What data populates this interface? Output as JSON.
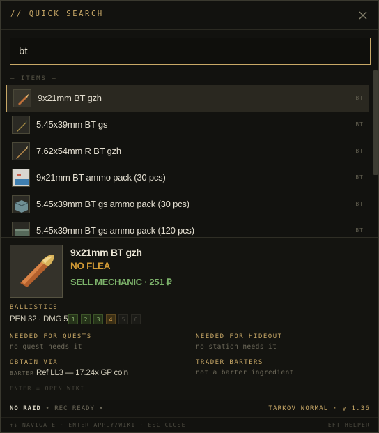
{
  "header": {
    "title": "// QUICK SEARCH",
    "close_icon": "close-icon"
  },
  "search": {
    "value": "bt",
    "placeholder": ""
  },
  "list": {
    "section_label": "— ITEMS —",
    "items": [
      {
        "name": "9x21mm BT gzh",
        "tag": "BT",
        "icon": "bullet-icon",
        "selected": true
      },
      {
        "name": "5.45x39mm BT gs",
        "tag": "BT",
        "icon": "rifle-round-icon",
        "selected": false
      },
      {
        "name": "7.62x54mm R BT gzh",
        "tag": "BT",
        "icon": "rifle-round-icon",
        "selected": false
      },
      {
        "name": "9x21mm BT ammo pack (30 pcs)",
        "tag": "BT",
        "icon": "ammo-pack-icon",
        "selected": false
      },
      {
        "name": "5.45x39mm BT gs ammo pack (30 pcs)",
        "tag": "BT",
        "icon": "ammo-box-icon",
        "selected": false
      },
      {
        "name": "5.45x39mm BT gs ammo pack (120 pcs)",
        "tag": "BT",
        "icon": "ammo-box-icon",
        "selected": false
      }
    ]
  },
  "detail": {
    "name": "9x21mm BT gzh",
    "flea": "NO FLEA",
    "sell": "SELL MECHANIC · 251 ₽",
    "ballistics_label": "BALLISTICS",
    "ballistics_stats": "PEN 32 · DMG 52",
    "armor_classes": [
      "1",
      "2",
      "3",
      "4",
      "5",
      "6"
    ],
    "quests_label": "NEEDED FOR QUESTS",
    "quests_value": "no quest needs it",
    "hideout_label": "NEEDED FOR HIDEOUT",
    "hideout_value": "no station needs it",
    "obtain_label": "OBTAIN VIA",
    "barters_label": "TRADER BARTERS",
    "barters_value": "not a barter ingredient",
    "obtain_kind": "BARTER",
    "obtain_value": "Ref LL3 — 17.24x GP coin",
    "hint": "ENTER = OPEN WIKI"
  },
  "status": {
    "raid": "NO RAID",
    "rec": "• REC READY •",
    "mode": "TARKOV NORMAL · γ 1.36"
  },
  "footer": {
    "keys": "↑↓ NAVIGATE · ENTER APPLY/WIKI · ESC CLOSE",
    "brand": "EFT HELPER"
  },
  "colors": {
    "accent": "#c8a867",
    "flea": "#d29a35",
    "sell": "#7cb26a"
  }
}
